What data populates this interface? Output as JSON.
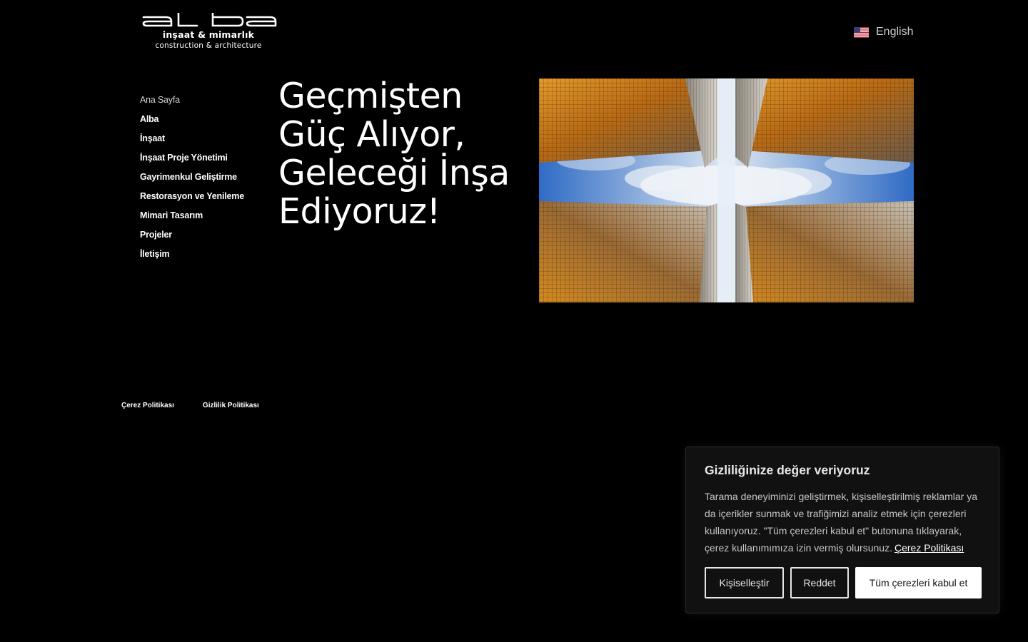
{
  "logo": {
    "sub_tr": "inşaat & mimarlık",
    "sub_en": "construction & architecture"
  },
  "language": {
    "label": "English",
    "icon": "us-flag-icon"
  },
  "nav": {
    "items": [
      {
        "label": "Ana Sayfa"
      },
      {
        "label": "Alba"
      },
      {
        "label": "İnşaat"
      },
      {
        "label": "İnşaat Proje Yönetimi"
      },
      {
        "label": "Gayrimenkul Geliştirme"
      },
      {
        "label": "Restorasyon ve Yenileme"
      },
      {
        "label": "Mimari Tasarım"
      },
      {
        "label": "Projeler"
      },
      {
        "label": "İletişim"
      }
    ]
  },
  "hero": {
    "headline": "Geçmişten Güç Alıyor, Geleceği İnşa Ediyoruz!"
  },
  "footer": {
    "cookie_policy": "Çerez Politikası",
    "privacy_policy": "Gizlilik Politikası"
  },
  "cookie_banner": {
    "title": "Gizliliğinize değer veriyoruz",
    "text": "Tarama deneyiminizi geliştirmek, kişiselleştirilmiş reklamlar ya da içerikler sunmak ve trafiğimizi analiz etmek için çerezleri kullanıyoruz. \"Tüm çerezleri kabul et\" butonuna tıklayarak, çerez kullanımımıza izin vermiş olursunuz.",
    "link": "Çerez Politikası",
    "customize": "Kişiselleştir",
    "reject": "Reddet",
    "accept_all": "Tüm çerezleri kabul et"
  }
}
